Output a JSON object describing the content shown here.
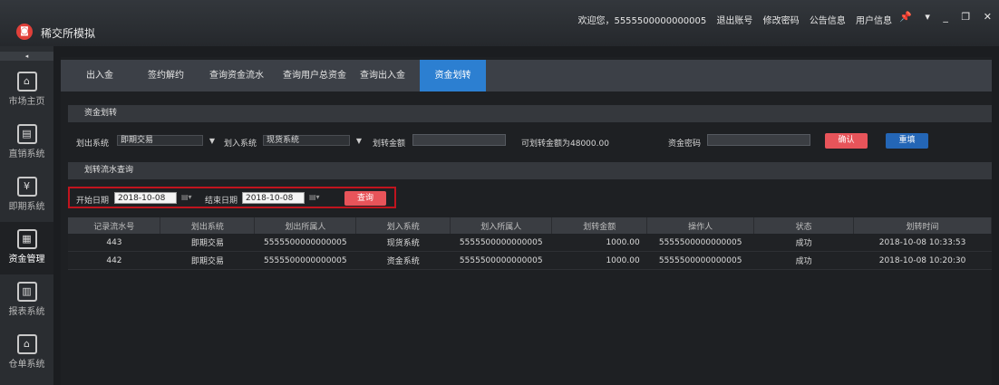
{
  "app": {
    "title": "稀交所模拟",
    "logo_text": "◙"
  },
  "topmenu": {
    "welcome": "欢迎您，5555500000000005",
    "logout": "退出账号",
    "change_pwd": "修改密码",
    "notice": "公告信息",
    "user_info": "用户信息"
  },
  "window": {
    "pin": "📌",
    "dropdown": "▾",
    "minimize": "_",
    "restore": "❐",
    "close": "✕"
  },
  "sidebar": {
    "collapse": "◂",
    "items": [
      {
        "label": "市场主页",
        "icon": "⌂"
      },
      {
        "label": "直销系统",
        "icon": "▤"
      },
      {
        "label": "即期系统",
        "icon": "¥"
      },
      {
        "label": "资金管理",
        "icon": "▦"
      },
      {
        "label": "报表系统",
        "icon": "▥"
      },
      {
        "label": "仓单系统",
        "icon": "⌂"
      }
    ]
  },
  "tabs": [
    "出入金",
    "签约解约",
    "查询资金流水",
    "查询用户总资金",
    "查询出入金",
    "资金划转"
  ],
  "transfer": {
    "section_title": "资金划转",
    "out_label": "划出系统",
    "out_value": "即期交易",
    "in_label": "划入系统",
    "in_value": "现货系统",
    "amount_label": "划转金额",
    "available_text": "可划转金额为48000.00",
    "pwd_label": "资金密码",
    "confirm": "确认",
    "reset": "重填"
  },
  "query": {
    "section_title": "划转流水查询",
    "start_label": "开始日期",
    "start_value": "2018-10-08",
    "end_label": "结束日期",
    "end_value": "2018-10-08",
    "search": "查询"
  },
  "table": {
    "headers": [
      "记录流水号",
      "划出系统",
      "划出所属人",
      "划入系统",
      "划入所属人",
      "划转金额",
      "操作人",
      "状态",
      "划转时间"
    ],
    "rows": [
      [
        "443",
        "即期交易",
        "5555500000000005",
        "现货系统",
        "5555500000000005",
        "1000.00",
        "5555500000000005",
        "成功",
        "2018-10-08 10:33:53"
      ],
      [
        "442",
        "即期交易",
        "5555500000000005",
        "资金系统",
        "5555500000000005",
        "1000.00",
        "5555500000000005",
        "成功",
        "2018-10-08 10:20:30"
      ]
    ]
  }
}
